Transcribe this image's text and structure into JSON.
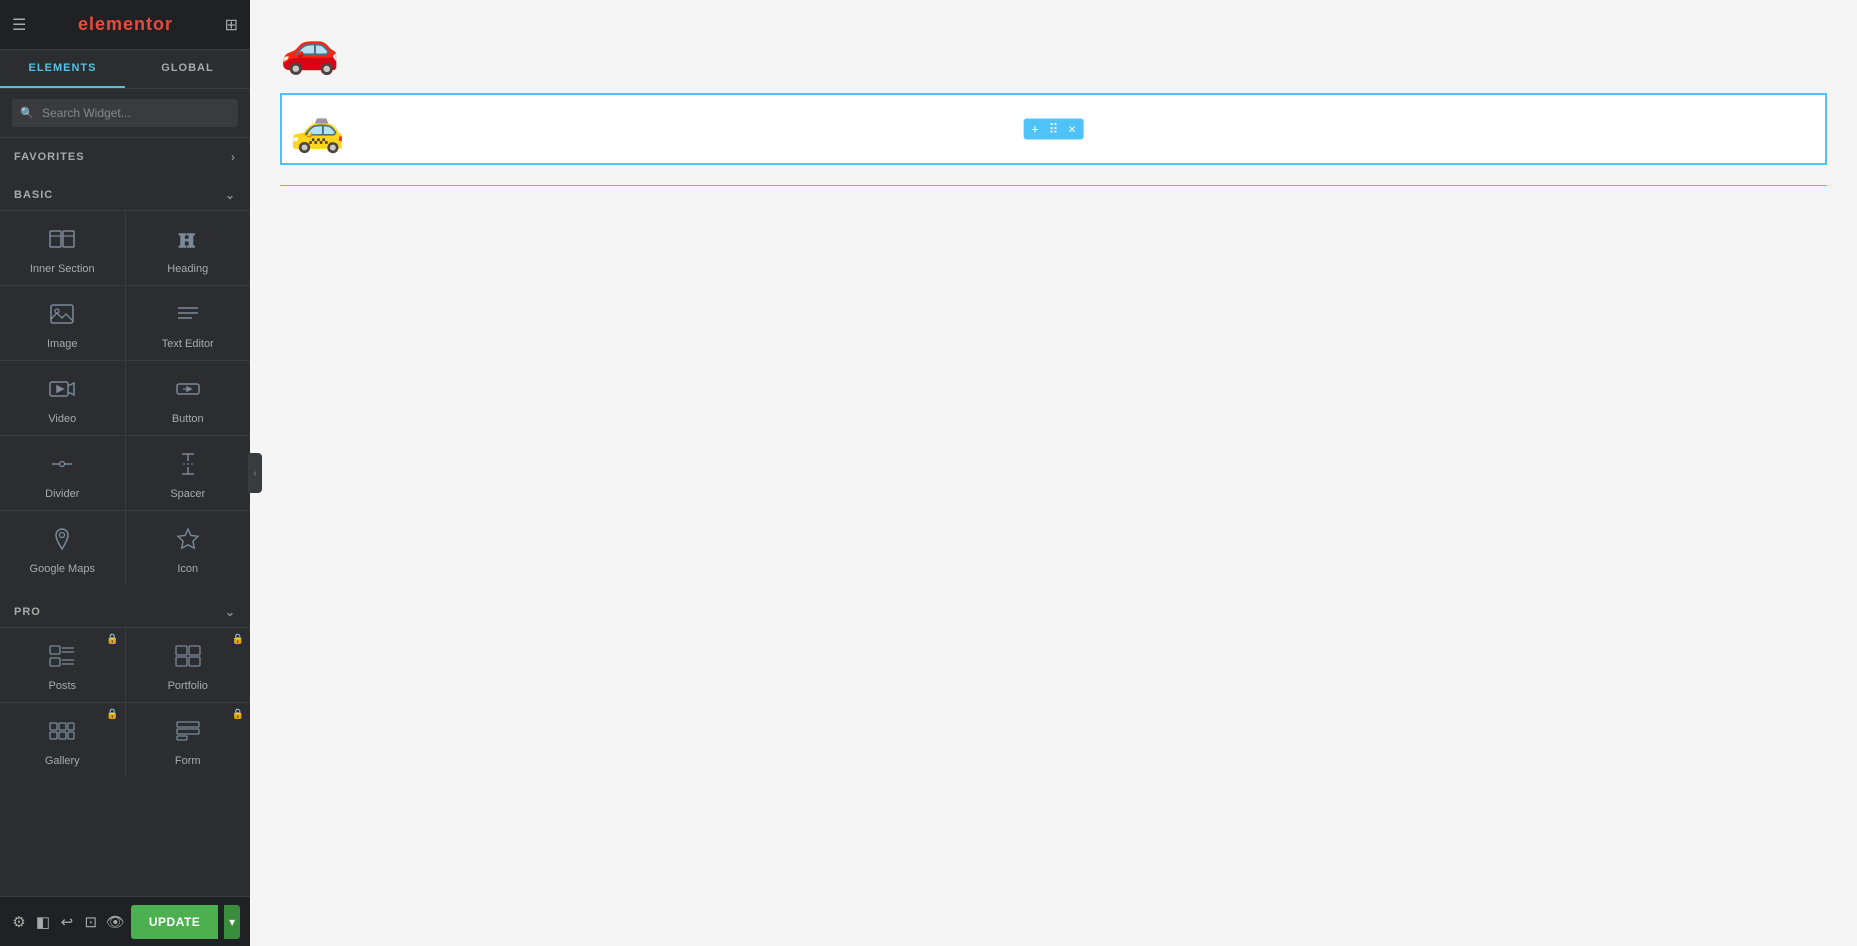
{
  "app": {
    "title": "elementor",
    "colors": {
      "accent": "#56c0e0",
      "green": "#4CAF50",
      "dark_green": "#388E3C",
      "sidebar_bg": "#2c2d30",
      "header_bg": "#1f2124",
      "selected_border": "#4fc3f7",
      "car_black": "#1a1a1a",
      "car_orange": "#f5a623"
    }
  },
  "tabs": [
    {
      "id": "elements",
      "label": "ELEMENTS",
      "active": true
    },
    {
      "id": "global",
      "label": "GLOBAL",
      "active": false
    }
  ],
  "search": {
    "placeholder": "Search Widget..."
  },
  "sections": [
    {
      "id": "favorites",
      "label": "FAVORITES",
      "expanded": true,
      "widgets": []
    },
    {
      "id": "basic",
      "label": "BASIC",
      "expanded": true,
      "widgets": [
        {
          "id": "inner-section",
          "label": "Inner Section",
          "icon": "inner-section-icon"
        },
        {
          "id": "heading",
          "label": "Heading",
          "icon": "heading-icon"
        },
        {
          "id": "image",
          "label": "Image",
          "icon": "image-icon"
        },
        {
          "id": "text-editor",
          "label": "Text Editor",
          "icon": "text-editor-icon"
        },
        {
          "id": "video",
          "label": "Video",
          "icon": "video-icon"
        },
        {
          "id": "button",
          "label": "Button",
          "icon": "button-icon"
        },
        {
          "id": "divider",
          "label": "Divider",
          "icon": "divider-icon"
        },
        {
          "id": "spacer",
          "label": "Spacer",
          "icon": "spacer-icon"
        },
        {
          "id": "google-maps",
          "label": "Google Maps",
          "icon": "google-maps-icon"
        },
        {
          "id": "icon",
          "label": "Icon",
          "icon": "icon-widget-icon"
        }
      ]
    },
    {
      "id": "pro",
      "label": "PRO",
      "expanded": true,
      "widgets": [
        {
          "id": "posts",
          "label": "Posts",
          "icon": "posts-icon",
          "locked": true
        },
        {
          "id": "portfolio",
          "label": "Portfolio",
          "icon": "portfolio-icon",
          "locked": true
        },
        {
          "id": "gallery",
          "label": "Gallery",
          "icon": "gallery-icon",
          "locked": true
        },
        {
          "id": "form",
          "label": "Form",
          "icon": "form-icon",
          "locked": true
        }
      ]
    }
  ],
  "footer": {
    "update_label": "UPDATE",
    "icons": [
      "settings-icon",
      "layers-icon",
      "history-icon",
      "navigator-icon",
      "eye-icon"
    ]
  },
  "canvas": {
    "sections": [
      {
        "id": "car-black-section",
        "selected": false
      },
      {
        "id": "car-orange-section",
        "selected": true,
        "toolbar": {
          "add": "+",
          "move": "⠿",
          "close": "×"
        }
      }
    ]
  }
}
